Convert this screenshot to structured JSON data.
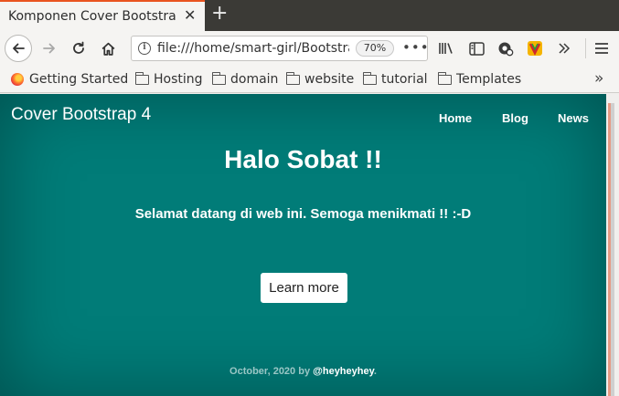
{
  "browser": {
    "tab_title": "Komponen Cover Bootstrap",
    "tab_close": "✕",
    "new_tab": "+",
    "url": "file:///home/smart-girl/Bootstra",
    "zoom": "70%",
    "page_actions": "•••",
    "bookmarks": [
      {
        "label": "Getting Started",
        "icon": "firefox-icon"
      },
      {
        "label": "Hosting",
        "icon": "folder-icon"
      },
      {
        "label": "domain",
        "icon": "folder-icon"
      },
      {
        "label": "website",
        "icon": "folder-icon"
      },
      {
        "label": "tutorial",
        "icon": "folder-icon"
      },
      {
        "label": "Templates",
        "icon": "folder-icon"
      }
    ]
  },
  "page": {
    "brand": "Cover Bootstrap 4",
    "nav": [
      "Home",
      "Blog",
      "News"
    ],
    "title": "Halo Sobat !!",
    "lead": "Selamat datang di web ini. Semoga menikmati !! :-D",
    "button": "Learn more",
    "footer_prefix": "October, 2020 by ",
    "footer_handle": "@heyheyhey",
    "footer_suffix": ".",
    "background_color": "#017c78",
    "accent_color": "#e95420"
  }
}
